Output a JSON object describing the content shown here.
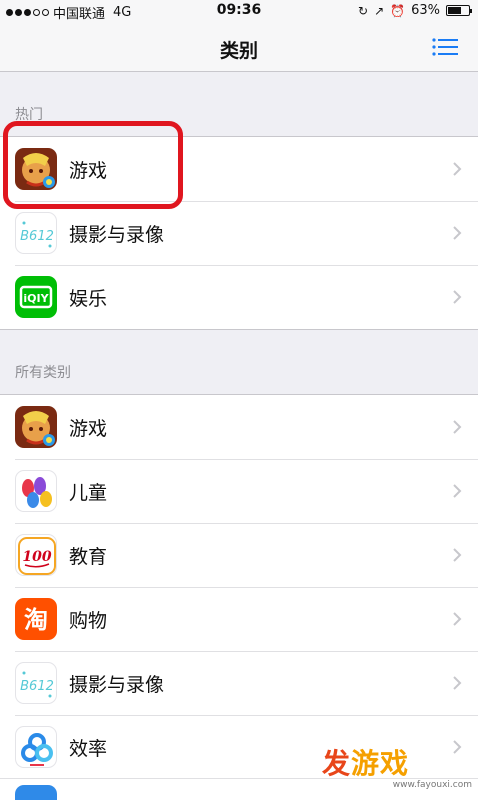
{
  "status_bar": {
    "carrier": "中国联通",
    "network": "4G",
    "time": "09:36",
    "battery": "63%",
    "battery_level": 0.63
  },
  "nav": {
    "title": "类别"
  },
  "sections": {
    "hot": {
      "header": "热门",
      "items": [
        {
          "label": "游戏",
          "icon": "game-icon"
        },
        {
          "label": "摄影与录像",
          "icon": "b612-camera-icon"
        },
        {
          "label": "娱乐",
          "icon": "iqiyi-icon"
        }
      ]
    },
    "all": {
      "header": "所有类别",
      "items": [
        {
          "label": "游戏",
          "icon": "game-icon"
        },
        {
          "label": "儿童",
          "icon": "kids-hands-icon"
        },
        {
          "label": "教育",
          "icon": "score-100-icon"
        },
        {
          "label": "购物",
          "icon": "taobao-icon"
        },
        {
          "label": "摄影与录像",
          "icon": "b612-camera-icon"
        },
        {
          "label": "效率",
          "icon": "baidu-cloud-icon"
        }
      ]
    }
  },
  "icon_texts": {
    "b612": "B612",
    "iqiyi": "iQIY",
    "score": "100",
    "taobao": "淘"
  },
  "watermark": {
    "text_a": "发",
    "text_b": "游戏",
    "url": "www.fayouxi.com"
  },
  "colors": {
    "highlight": "#e0161f",
    "iqiyi_green": "#00be06",
    "taobao_orange": "#ff5000",
    "watermark_orange": "#f5a000"
  }
}
